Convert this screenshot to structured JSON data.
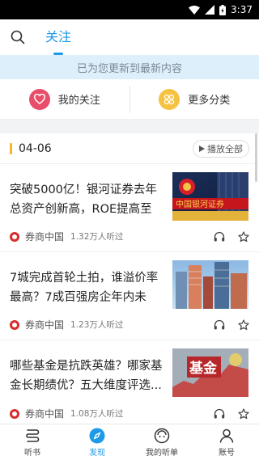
{
  "status": {
    "time": "3:37"
  },
  "header": {
    "tab_label": "关注"
  },
  "banner": {
    "text": "已为您更新到最新内容"
  },
  "quicknav": [
    {
      "label": "我的关注",
      "icon": "heart-icon"
    },
    {
      "label": "更多分类",
      "icon": "grid-icon"
    }
  ],
  "feed": {
    "date": "04-06",
    "play_all_label": "播放全部",
    "items": [
      {
        "title": "突破5000亿！银河证券去年总资产创新高，ROE提高至1...",
        "source": "券商中国",
        "listens": "1.32万人听过",
        "thumb_text": "中国银河证券"
      },
      {
        "title": "7城完成首轮土拍，谁溢价率最高？7成百强房企年内未拿...",
        "source": "券商中国",
        "listens": "1.23万人听过",
        "thumb_text": ""
      },
      {
        "title": "哪些基金是抗跌英雄？哪家基金长期绩优？五大维度评选...",
        "source": "券商中国",
        "listens": "1.08万人听过",
        "thumb_text": "基金"
      }
    ]
  },
  "bottom_nav": [
    {
      "label": "听书",
      "icon": "book-icon",
      "active": false
    },
    {
      "label": "发现",
      "icon": "compass-icon",
      "active": true
    },
    {
      "label": "我的听单",
      "icon": "playlist-icon",
      "active": false
    },
    {
      "label": "账号",
      "icon": "account-icon",
      "active": false
    }
  ],
  "colors": {
    "accent": "#1e9ae8",
    "banner_bg": "#dceffb",
    "date_bar": "#f5b728"
  }
}
